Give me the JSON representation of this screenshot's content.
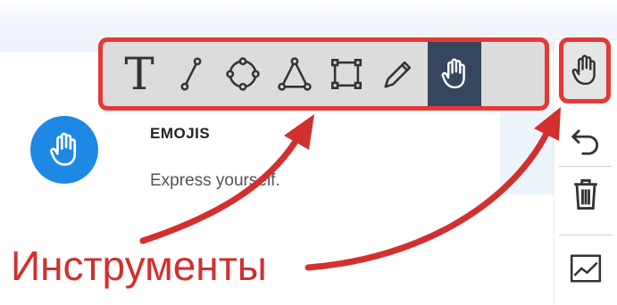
{
  "toolbar": {
    "tools": [
      {
        "name": "text",
        "label": "T"
      },
      {
        "name": "line"
      },
      {
        "name": "circle"
      },
      {
        "name": "polygon"
      },
      {
        "name": "rectangle"
      },
      {
        "name": "pencil"
      },
      {
        "name": "hand",
        "active": true
      }
    ]
  },
  "right_toolbar": {
    "items": [
      "hand-icon",
      "undo-icon",
      "trash-icon",
      "chart-icon"
    ]
  },
  "card": {
    "title": "EMOJIS",
    "subtitle": "Express yourself."
  },
  "annotation": {
    "text": "Инструменты"
  },
  "colors": {
    "highlight": "#e53935",
    "annotation": "#d32f2f",
    "active_tool": "#34475e",
    "avatar": "#1e88e5",
    "toolbar_bg": "#dcdcdc"
  }
}
